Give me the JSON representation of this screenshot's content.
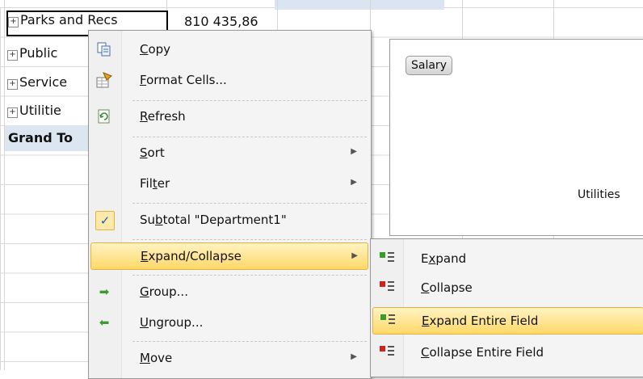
{
  "sheet": {
    "rows": [
      {
        "label": "Parks and Recs",
        "value": "810 435,86"
      },
      {
        "label": "Public"
      },
      {
        "label": "Service"
      },
      {
        "label": "Utilitie"
      },
      {
        "label": "Grand To"
      }
    ],
    "expand_glyph": "+"
  },
  "chart": {
    "field_button": "Salary",
    "axis_label": "Utilities"
  },
  "context_menu": {
    "items": [
      {
        "label_pre": "",
        "key": "C",
        "label_post": "opy",
        "icon": "copy-icon"
      },
      {
        "label_pre": "",
        "key": "F",
        "label_post": "ormat Cells...",
        "icon": "format-cells-icon"
      },
      {
        "label_pre": "",
        "key": "R",
        "label_post": "efresh",
        "icon": "refresh-icon"
      },
      {
        "label_pre": "",
        "key": "S",
        "label_post": "ort",
        "submenu": true
      },
      {
        "label_pre": "Fil",
        "key": "t",
        "label_post": "er",
        "submenu": true
      },
      {
        "label_pre": "Su",
        "key": "b",
        "label_post": "total \"Department1\"",
        "checked": true
      },
      {
        "label_pre": "",
        "key": "E",
        "label_post": "xpand/Collapse",
        "submenu": true,
        "highlighted": true
      },
      {
        "label_pre": "",
        "key": "G",
        "label_post": "roup...",
        "icon": "group-arrow-icon"
      },
      {
        "label_pre": "",
        "key": "U",
        "label_post": "ngroup...",
        "icon": "ungroup-arrow-icon"
      },
      {
        "label_pre": "",
        "key": "M",
        "label_post": "ove",
        "submenu": true
      }
    ],
    "submenu_arrow": "▶",
    "check_glyph": "✓",
    "group_glyph": "➡",
    "ungroup_glyph": "⬅"
  },
  "submenu": {
    "items": [
      {
        "label_pre": "",
        "key": "x",
        "label_post": "",
        "full": "Expand",
        "icon": "expand-icon"
      },
      {
        "label_pre": "",
        "key": "C",
        "label_post": "ollapse",
        "icon": "collapse-icon"
      },
      {
        "label_pre": "",
        "key": "E",
        "label_post": "xpand Entire Field",
        "icon": "expand-entire-icon",
        "highlighted": true
      },
      {
        "label_pre": "",
        "key": "C",
        "label_post": "ollapse Entire Field",
        "icon": "collapse-entire-icon"
      }
    ]
  },
  "colors": {
    "highlight": "#ffd867",
    "plus_green": "#3a9b2f",
    "minus_red": "#c9261f"
  }
}
